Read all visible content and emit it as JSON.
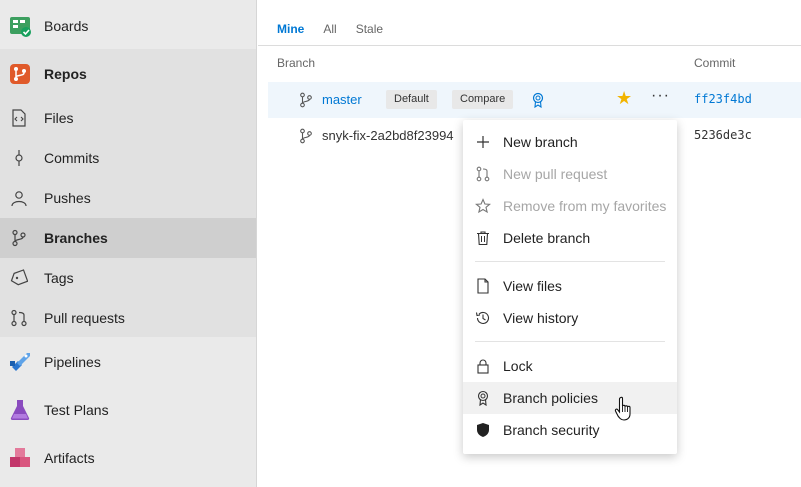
{
  "sidebar": {
    "items": [
      {
        "label": "Boards"
      },
      {
        "label": "Repos"
      },
      {
        "label": "Files"
      },
      {
        "label": "Commits"
      },
      {
        "label": "Pushes"
      },
      {
        "label": "Branches"
      },
      {
        "label": "Tags"
      },
      {
        "label": "Pull requests"
      },
      {
        "label": "Pipelines"
      },
      {
        "label": "Test Plans"
      },
      {
        "label": "Artifacts"
      }
    ],
    "selected": "Branches"
  },
  "tabs": [
    {
      "label": "Mine",
      "active": true
    },
    {
      "label": "All",
      "active": false
    },
    {
      "label": "Stale",
      "active": false
    }
  ],
  "columns": {
    "branch": "Branch",
    "commit": "Commit"
  },
  "branches": [
    {
      "name": "master",
      "badges": [
        "Default",
        "Compare"
      ],
      "commit": "ff23f4bd",
      "favorite": true
    },
    {
      "name": "snyk-fix-2a2bd8f23994",
      "badges": [],
      "commit": "5236de3c",
      "favorite": false
    }
  ],
  "context_menu": {
    "items": [
      {
        "label": "New branch",
        "icon": "plus-icon",
        "disabled": false
      },
      {
        "label": "New pull request",
        "icon": "pull-request-icon",
        "disabled": true
      },
      {
        "label": "Remove from my favorites",
        "icon": "star-outline-icon",
        "disabled": true
      },
      {
        "label": "Delete branch",
        "icon": "trash-icon",
        "disabled": false
      },
      {
        "label": "View files",
        "icon": "file-icon",
        "disabled": false
      },
      {
        "label": "View history",
        "icon": "history-icon",
        "disabled": false
      },
      {
        "label": "Lock",
        "icon": "lock-icon",
        "disabled": false
      },
      {
        "label": "Branch policies",
        "icon": "policy-badge-icon",
        "disabled": false
      },
      {
        "label": "Branch security",
        "icon": "shield-icon",
        "disabled": false
      }
    ],
    "hovered": "Branch policies"
  },
  "colors": {
    "accent": "#0078d4",
    "star": "#f2b400",
    "repos_orange": "#e05a2a",
    "boards_green": "#009b5a",
    "pipelines_blue": "#2a76cf",
    "testplans_purple": "#8a4bbf",
    "artifacts_pink": "#c2366a"
  }
}
